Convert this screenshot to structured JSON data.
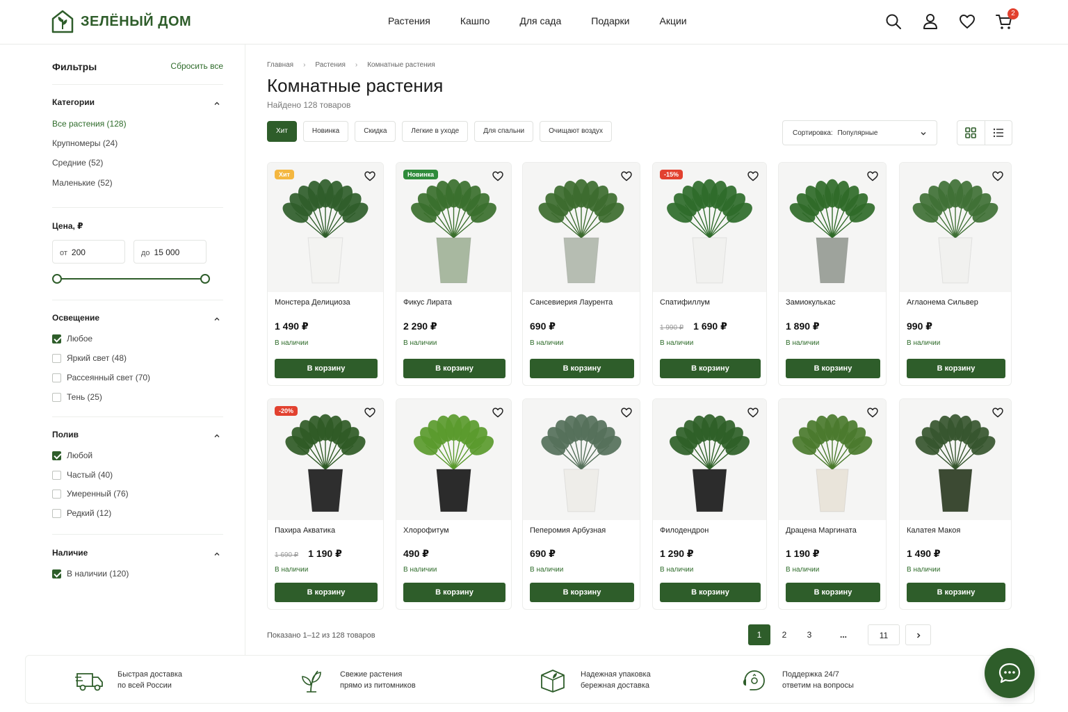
{
  "brand": {
    "name": "ЗЕЛЁНЫЙ ДОМ",
    "color": "#2e5d2a"
  },
  "nav": [
    "Растения",
    "Кашпо",
    "Для сада",
    "Подарки",
    "Акции"
  ],
  "header_icons": [
    "search-icon",
    "user-icon",
    "heart-icon",
    "cart-icon"
  ],
  "cart_count": "2",
  "filters": {
    "title": "Фильтры",
    "reset": "Сбросить все",
    "categories": {
      "title": "Категории",
      "items": [
        "Все растения  (128)",
        "Крупномеры  (24)",
        "Средние  (52)",
        "Маленькие  (52)"
      ]
    },
    "price": {
      "title": "Цена, ₽",
      "from_prefix": "от",
      "from_value": "200",
      "to_prefix": "до",
      "to_value": "15 000"
    },
    "light": {
      "title": "Освещение",
      "items": [
        "Любое",
        "Яркий свет  (48)",
        "Рассеянный свет  (70)",
        "Тень  (25)"
      ]
    },
    "water": {
      "title": "Полив",
      "items": [
        "Любой",
        "Частый  (40)",
        "Умеренный  (76)",
        "Редкий  (12)"
      ]
    },
    "stock": {
      "title": "Наличие",
      "items": [
        "В наличии  (120)"
      ]
    }
  },
  "breadcrumb": [
    "Главная",
    "Растения",
    "Комнатные растения"
  ],
  "page_title": "Комнатные растения",
  "found": "Найдено 128 товаров",
  "chips": [
    "Хит",
    "Новинка",
    "Скидка",
    "Легкие в уходе",
    "Для спальни",
    "Очищают воздух"
  ],
  "sort": {
    "label": "Сортировка:",
    "value": "Популярные"
  },
  "products": [
    {
      "name": "Монстера Делициоза",
      "price": "1 490 ₽",
      "old": "",
      "badge": "Хит",
      "stock": "В наличии",
      "cta": "В корзину"
    },
    {
      "name": "Фикус Лирата",
      "price": "2 290 ₽",
      "old": "",
      "badge": "Новинка",
      "stock": "В наличии",
      "cta": "В корзину"
    },
    {
      "name": "Сансевиерия Лаурента",
      "price": "690 ₽",
      "old": "",
      "badge": "",
      "stock": "В наличии",
      "cta": "В корзину"
    },
    {
      "name": "Спатифиллум",
      "price": "1 690 ₽",
      "old": "1 990 ₽",
      "badge": "-15%",
      "stock": "В наличии",
      "cta": "В корзину"
    },
    {
      "name": "Замиокулькас",
      "price": "1 890 ₽",
      "old": "",
      "badge": "",
      "stock": "В наличии",
      "cta": "В корзину"
    },
    {
      "name": "Аглаонема Сильвер",
      "price": "990 ₽",
      "old": "",
      "badge": "",
      "stock": "В наличии",
      "cta": "В корзину"
    },
    {
      "name": "Пахира Акватика",
      "price": "1 190 ₽",
      "old": "1 690 ₽",
      "badge": "-20%",
      "stock": "В наличии",
      "cta": "В корзину"
    },
    {
      "name": "Хлорофитум",
      "price": "490 ₽",
      "old": "",
      "badge": "",
      "stock": "В наличии",
      "cta": "В корзину"
    },
    {
      "name": "Пеперомия Арбузная",
      "price": "690 ₽",
      "old": "",
      "badge": "",
      "stock": "В наличии",
      "cta": "В корзину"
    },
    {
      "name": "Филодендрон",
      "price": "1 290 ₽",
      "old": "",
      "badge": "",
      "stock": "В наличии",
      "cta": "В корзину"
    },
    {
      "name": "Драцена Маргината",
      "price": "1 190 ₽",
      "old": "",
      "badge": "",
      "stock": "В наличии",
      "cta": "В корзину"
    },
    {
      "name": "Калатея Макоя",
      "price": "1 490 ₽",
      "old": "",
      "badge": "",
      "stock": "В наличии",
      "cta": "В корзину"
    }
  ],
  "pagination": {
    "shown": "Показано 1–12 из 128 товаров",
    "pages": [
      "1",
      "2",
      "3",
      "...",
      "11"
    ],
    "current": "1"
  },
  "features": [
    {
      "icon": "truck-icon",
      "line1": "Быстрая доставка",
      "line2": "по всей России"
    },
    {
      "icon": "leaf-icon",
      "line1": "Свежие растения",
      "line2": "прямо из питомников"
    },
    {
      "icon": "box-icon",
      "line1": "Надежная упаковка",
      "line2": "бережная доставка"
    },
    {
      "icon": "support-icon",
      "line1": "Поддержка 24/7",
      "line2": "ответим на вопросы"
    }
  ]
}
